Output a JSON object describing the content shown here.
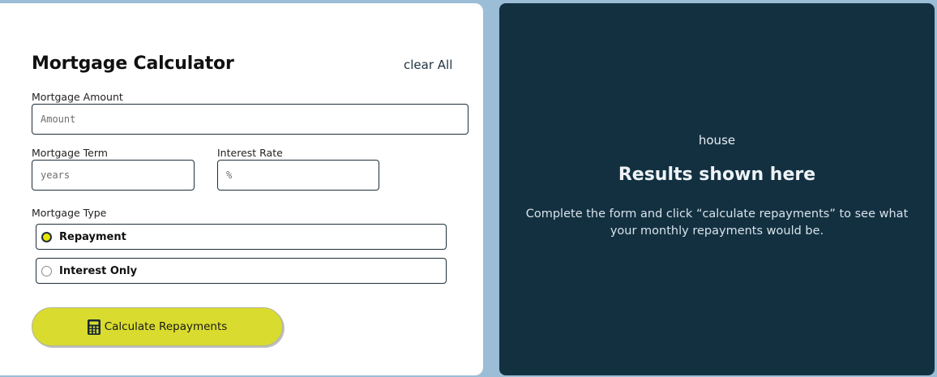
{
  "form": {
    "title": "Mortgage Calculator",
    "clear_all": "clear All",
    "amount": {
      "label": "Mortgage Amount",
      "placeholder": "Amount",
      "value": ""
    },
    "term": {
      "label": "Mortgage Term",
      "placeholder": "years",
      "value": ""
    },
    "rate": {
      "label": "Interest Rate",
      "placeholder": "%",
      "value": ""
    },
    "type": {
      "label": "Mortgage Type",
      "options": [
        {
          "label": "Repayment",
          "checked": true
        },
        {
          "label": "Interest Only",
          "checked": false
        }
      ]
    },
    "submit_label": "Calculate Repayments"
  },
  "results": {
    "image_alt": "house",
    "title": "Results shown here",
    "description": "Complete the form and click “calculate repayments” to see what your monthly repayments would be."
  },
  "colors": {
    "background": "#9cbdd6",
    "panel_dark": "#133041",
    "accent_lime": "#d9dc2f",
    "border": "#1e2f3a"
  }
}
